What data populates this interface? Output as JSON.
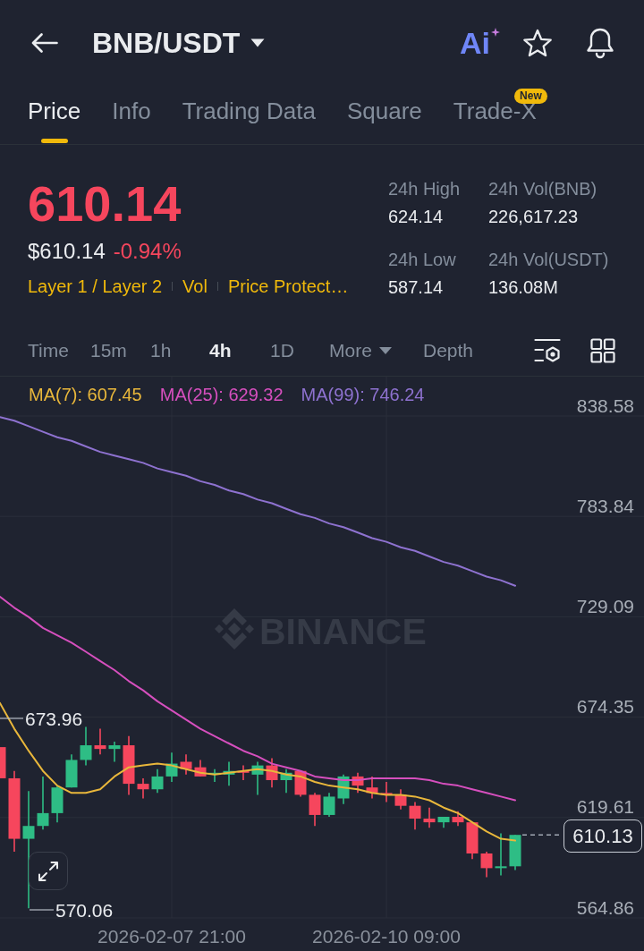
{
  "header": {
    "title": "BNB/USDT",
    "ai_label": "Ai"
  },
  "tabs": [
    {
      "label": "Price",
      "selected": true
    },
    {
      "label": "Info",
      "selected": false
    },
    {
      "label": "Trading Data",
      "selected": false
    },
    {
      "label": "Square",
      "selected": false
    },
    {
      "label": "Trade-X",
      "selected": false,
      "badge": "New"
    }
  ],
  "summary": {
    "last_price": "610.14",
    "falling": true,
    "fiat_price": "$610.14",
    "change": "-0.94%",
    "tags": [
      "Layer 1 / Layer 2",
      "Vol",
      "Price Protect…"
    ],
    "stats": [
      {
        "label": "24h High",
        "value": "624.14"
      },
      {
        "label": "24h Vol(BNB)",
        "value": "226,617.23"
      },
      {
        "label": "24h Low",
        "value": "587.14"
      },
      {
        "label": "24h Vol(USDT)",
        "value": "136.08M"
      }
    ]
  },
  "intervals": [
    {
      "label": "Time",
      "kind": "option",
      "selected": false
    },
    {
      "label": "15m",
      "kind": "option",
      "selected": false
    },
    {
      "label": "1h",
      "kind": "option",
      "selected": false
    },
    {
      "label": "4h",
      "kind": "option",
      "selected": true
    },
    {
      "label": "1D",
      "kind": "option",
      "selected": false
    },
    {
      "label": "More",
      "kind": "dropdown",
      "selected": false
    },
    {
      "label": "Depth",
      "kind": "option",
      "selected": false
    }
  ],
  "chart": {
    "chart_data": {
      "type": "candlestick",
      "grid": true,
      "categories": [
        null,
        null,
        null,
        null,
        null,
        null,
        null,
        null,
        null,
        null,
        null,
        null,
        "2026-02-07 21:00",
        null,
        null,
        null,
        null,
        null,
        null,
        null,
        null,
        null,
        null,
        null,
        null,
        null,
        null,
        "2026-02-10 09:00",
        null,
        null,
        null,
        null,
        null,
        null,
        null,
        null,
        null
      ],
      "ylim": [
        564.86,
        838.58
      ],
      "yticks": [
        838.58,
        783.84,
        729.09,
        674.35,
        619.61,
        564.86
      ],
      "ohlc": [
        [
          658,
          658,
          641,
          641
        ],
        [
          641,
          645,
          601,
          608
        ],
        [
          608,
          634,
          570.06,
          615
        ],
        [
          615,
          642,
          613,
          622
        ],
        [
          622,
          637,
          617,
          636
        ],
        [
          636,
          654,
          636,
          651
        ],
        [
          651,
          669,
          648,
          659
        ],
        [
          659,
          668,
          654,
          657
        ],
        [
          657,
          661,
          650,
          659
        ],
        [
          659,
          664,
          632,
          638
        ],
        [
          638,
          641,
          630,
          635
        ],
        [
          635,
          646,
          633,
          642
        ],
        [
          642,
          655,
          639,
          649
        ],
        [
          650,
          654,
          643,
          646
        ],
        [
          647,
          651,
          642,
          642
        ],
        [
          643,
          646,
          639,
          644
        ],
        [
          643,
          650,
          637,
          645
        ],
        [
          645,
          648,
          640,
          644
        ],
        [
          643,
          650,
          632,
          648
        ],
        [
          648,
          652,
          636,
          640
        ],
        [
          640,
          646,
          633,
          644
        ],
        [
          645,
          645,
          631,
          632
        ],
        [
          632,
          633,
          615,
          621
        ],
        [
          621,
          633,
          620,
          631
        ],
        [
          630,
          643,
          627,
          642
        ],
        [
          642,
          644,
          633,
          637
        ],
        [
          636,
          642,
          630,
          633
        ],
        [
          633,
          639,
          628,
          632
        ],
        [
          632,
          635,
          624,
          626
        ],
        [
          626,
          628,
          613,
          619
        ],
        [
          619,
          625,
          614,
          617
        ],
        [
          617,
          620,
          614,
          620
        ],
        [
          620,
          623,
          615,
          617
        ],
        [
          617,
          617,
          597,
          600
        ],
        [
          600,
          601,
          587,
          592
        ],
        [
          592,
          611,
          588,
          593
        ],
        [
          593,
          610.13,
          591,
          610.13
        ]
      ],
      "series": [
        {
          "name": "MA(7): 607.45",
          "type": "line",
          "color": "#e9b73b",
          "values": [
            682,
            668,
            656,
            645,
            637,
            633,
            633,
            635,
            642,
            647,
            648,
            649,
            648,
            646,
            644,
            643,
            644,
            645,
            646,
            645,
            643,
            642,
            639,
            637,
            636,
            635,
            633,
            632,
            632,
            631,
            629,
            625,
            622,
            617,
            612,
            608,
            607
          ]
        },
        {
          "name": "MA(25): 629.32",
          "type": "line",
          "color": "#d64fbe",
          "values": [
            740,
            734,
            729,
            723,
            719,
            715,
            710,
            705,
            700,
            694,
            689,
            683,
            678,
            673,
            668,
            664,
            660,
            656,
            653,
            649,
            647,
            645,
            642,
            641,
            640,
            640,
            641,
            641,
            641,
            641,
            640,
            638,
            637,
            635,
            633,
            631,
            629
          ]
        },
        {
          "name": "MA(99): 746.24",
          "type": "line",
          "color": "#8e72d0",
          "values": [
            838,
            836,
            833,
            830,
            827,
            825,
            822,
            819,
            817,
            815,
            813,
            810,
            808,
            806,
            803,
            801,
            798,
            796,
            793,
            791,
            788,
            785,
            783,
            780,
            778,
            775,
            772,
            770,
            767,
            765,
            762,
            759,
            757,
            754,
            751,
            749,
            746
          ]
        }
      ]
    },
    "watermark": "BINANCE",
    "high_label": "673.96",
    "low_label": "570.06",
    "last_price": "610.13"
  }
}
